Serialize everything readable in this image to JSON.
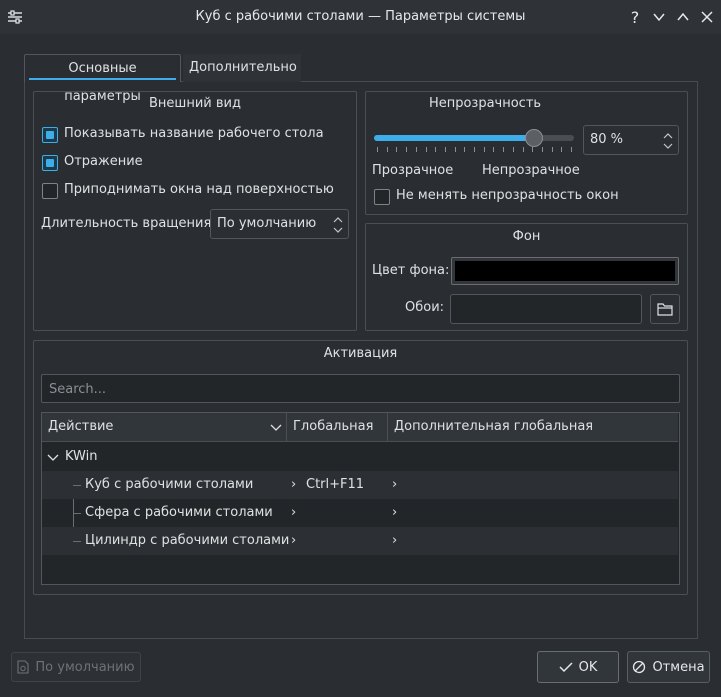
{
  "window": {
    "title": "Куб с рабочими столами — Параметры системы"
  },
  "tabs": [
    {
      "label": "Основные параметры",
      "active": true
    },
    {
      "label": "Дополнительно",
      "active": false
    }
  ],
  "appearance": {
    "title": "Внешний вид",
    "show_desktop_name": {
      "label": "Показывать название рабочего стола",
      "checked": true
    },
    "reflection": {
      "label": "Отражение",
      "checked": true
    },
    "raise_windows": {
      "label": "Приподнимать окна над поверхностью",
      "checked": false
    },
    "rotation_duration_label": "Длительность вращения:",
    "rotation_duration_value": "По умолчанию"
  },
  "opacity": {
    "title": "Непрозрачность",
    "value_text": "80 %",
    "value_fraction": 0.8,
    "min_label": "Прозрачное",
    "max_label": "Непрозрачное",
    "dont_change": {
      "label": "Не менять непрозрачность окон",
      "checked": false
    }
  },
  "background": {
    "title": "Фон",
    "color_label": "Цвет фона:",
    "color": "#000000",
    "wallpaper_label": "Обои:",
    "wallpaper_value": ""
  },
  "activation": {
    "title": "Активация",
    "search_placeholder": "Search...",
    "columns": [
      "Действие",
      "Глобальная",
      "Дополнительная глобальная"
    ],
    "group": "KWin",
    "rows": [
      {
        "action": "Куб с рабочими столами",
        "global": "Ctrl+F11",
        "alt": ""
      },
      {
        "action": "Сфера с рабочими столами",
        "global": "",
        "alt": ""
      },
      {
        "action": "Цилиндр с рабочими столами",
        "global": "",
        "alt": ""
      }
    ]
  },
  "buttons": {
    "defaults": "По умолчанию",
    "ok": "OK",
    "cancel": "Отмена"
  },
  "colors": {
    "accent": "#3daee9",
    "window_bg": "#2a2e32"
  }
}
